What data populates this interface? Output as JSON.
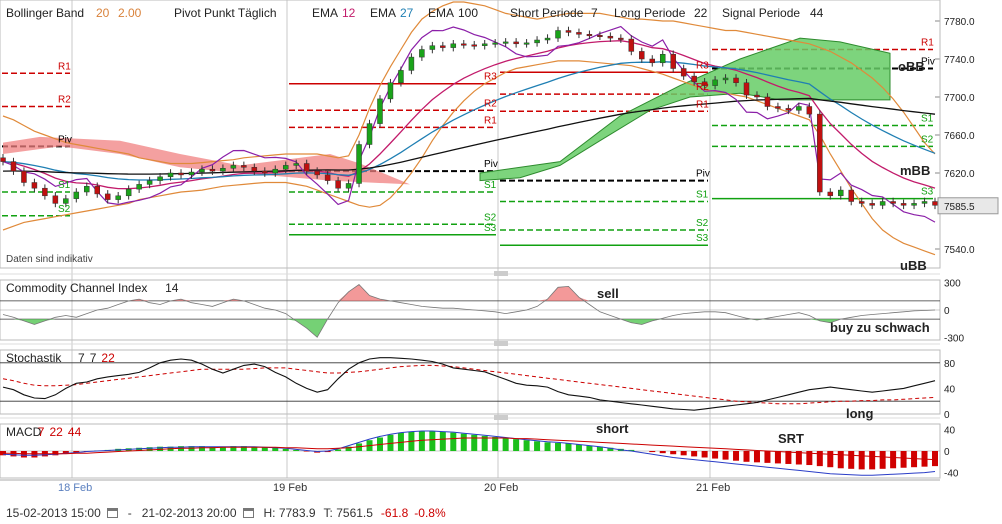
{
  "colors": {
    "red": "#cc0000",
    "green": "#11a111",
    "orange": "#d9823b",
    "purple": "#8b1fa8",
    "ema12": "#c21b6b",
    "ema27": "#1f7fb3",
    "ema100": "#111111",
    "bbLine": "#e08a3a",
    "cloudGreen": "#66cc66",
    "cloudRed": "#f08080"
  },
  "header": {
    "bollinger": {
      "label": "Bollinger Band",
      "p1": "20",
      "p2": "2.00"
    },
    "pivot": "Pivot Punkt Täglich",
    "ema": [
      {
        "label": "EMA",
        "p": "12"
      },
      {
        "label": "EMA",
        "p": "27"
      },
      {
        "label": "EMA",
        "p": "100"
      }
    ],
    "short": {
      "label": "Short Periode",
      "p": "7"
    },
    "long": {
      "label": "Long Periode",
      "p": "22"
    },
    "signal": {
      "label": "Signal Periode",
      "p": "44"
    }
  },
  "indikativ": "Daten sind indikativ",
  "price_ticks": [
    "7780.0",
    "7740.0",
    "7700.0",
    "7660.0",
    "7620.0",
    "7585.5",
    "7540.0"
  ],
  "last_price": "7585.5",
  "annotations": {
    "obb": "oBB",
    "mbb": "mBB",
    "ubb": "uBB",
    "sell": "sell",
    "buy": "buy zu schwach",
    "long": "long",
    "short": "short",
    "srt": "SRT"
  },
  "pivots": {
    "r1": "R1",
    "r2": "R2",
    "r3": "R3",
    "piv": "Piv",
    "s1": "S1",
    "s2": "S2",
    "s3": "S3"
  },
  "cci": {
    "label": "Commodity Channel Index",
    "p": "14",
    "ticks": [
      "300",
      "0",
      "-300"
    ]
  },
  "stoch": {
    "label": "Stochastik",
    "p1": "7",
    "p2": "7",
    "p3": "22",
    "ticks": [
      "80",
      "40",
      "0"
    ]
  },
  "macd": {
    "label": "MACD",
    "p1": "7",
    "p2": "22",
    "p3": "44",
    "ticks": [
      "40",
      "0",
      "-40"
    ]
  },
  "dates": [
    "18 Feb",
    "19 Feb",
    "20 Feb",
    "21 Feb"
  ],
  "footer": {
    "from": "15-02-2013 15:00",
    "sep": "-",
    "to": "21-02-2013 20:00",
    "high": "H: 7783.9",
    "low": "T: 7561.5",
    "chg": "-61.8",
    "pct": "-0.8%"
  },
  "chart_data": {
    "type": "candlestick",
    "title": "",
    "x_range": [
      "15-02-2013 15:00",
      "21-02-2013 20:00"
    ],
    "y_range": [
      7520,
      7800
    ],
    "close": [
      7632,
      7622,
      7610,
      7604,
      7596,
      7588,
      7593,
      7600,
      7606,
      7598,
      7592,
      7596,
      7603,
      7608,
      7612,
      7616,
      7620,
      7618,
      7621,
      7624,
      7622,
      7625,
      7628,
      7626,
      7622,
      7620,
      7624,
      7628,
      7630,
      7622,
      7618,
      7612,
      7604,
      7609,
      7650,
      7672,
      7698,
      7715,
      7728,
      7742,
      7750,
      7754,
      7752,
      7756,
      7755,
      7754,
      7756,
      7757,
      7758,
      7756,
      7757,
      7760,
      7762,
      7770,
      7768,
      7766,
      7765,
      7764,
      7762,
      7761,
      7748,
      7740,
      7736,
      7745,
      7730,
      7722,
      7716,
      7712,
      7718,
      7720,
      7715,
      7702,
      7700,
      7690,
      7688,
      7686,
      7690,
      7682,
      7600,
      7596,
      7602,
      7590,
      7588,
      7586,
      7590,
      7588,
      7586,
      7588,
      7590,
      7586
    ],
    "bb_upper": [
      7680,
      7676,
      7670,
      7664,
      7660,
      7656,
      7652,
      7650,
      7648,
      7646,
      7644,
      7642,
      7640,
      7636,
      7634,
      7632,
      7630,
      7630,
      7630,
      7631,
      7632,
      7633,
      7634,
      7636,
      7637,
      7638,
      7639,
      7640,
      7640,
      7640,
      7640,
      7638,
      7636,
      7638,
      7660,
      7688,
      7712,
      7732,
      7750,
      7768,
      7782,
      7790,
      7796,
      7800,
      7800,
      7798,
      7796,
      7792,
      7788,
      7786,
      7784,
      7782,
      7784,
      7786,
      7788,
      7788,
      7788,
      7788,
      7786,
      7784,
      7782,
      7782,
      7781,
      7780,
      7780,
      7778,
      7776,
      7774,
      7772,
      7770,
      7770,
      7768,
      7766,
      7764,
      7762,
      7760,
      7758,
      7756,
      7752,
      7748,
      7742,
      7736,
      7728,
      7720,
      7710,
      7698,
      7684,
      7668,
      7652,
      7640
    ],
    "bb_lower": [
      7560,
      7564,
      7568,
      7570,
      7572,
      7574,
      7576,
      7578,
      7580,
      7582,
      7584,
      7586,
      7588,
      7592,
      7594,
      7596,
      7598,
      7600,
      7601,
      7602,
      7604,
      7606,
      7607,
      7608,
      7609,
      7610,
      7610,
      7610,
      7608,
      7606,
      7602,
      7598,
      7594,
      7590,
      7586,
      7584,
      7586,
      7594,
      7606,
      7620,
      7636,
      7654,
      7670,
      7684,
      7696,
      7706,
      7714,
      7720,
      7726,
      7730,
      7732,
      7734,
      7736,
      7738,
      7738,
      7738,
      7737,
      7736,
      7735,
      7734,
      7733,
      7730,
      7727,
      7724,
      7720,
      7716,
      7712,
      7708,
      7706,
      7704,
      7702,
      7700,
      7696,
      7692,
      7688,
      7684,
      7680,
      7676,
      7660,
      7640,
      7622,
      7604,
      7588,
      7572,
      7560,
      7552,
      7546,
      7542,
      7538,
      7534
    ],
    "cci": [
      -50,
      -80,
      -120,
      -160,
      -120,
      -80,
      -60,
      -80,
      -40,
      0,
      20,
      60,
      100,
      120,
      80,
      60,
      100,
      120,
      80,
      60,
      40,
      80,
      120,
      100,
      60,
      20,
      0,
      -40,
      -120,
      -200,
      -300,
      -100,
      80,
      200,
      280,
      160,
      120,
      100,
      80,
      60,
      40,
      30,
      20,
      20,
      10,
      0,
      -10,
      -20,
      -40,
      -20,
      0,
      40,
      120,
      250,
      260,
      140,
      60,
      -20,
      -60,
      -100,
      -140,
      -160,
      -120,
      -90,
      -60,
      -40,
      -30,
      -20,
      -20,
      -30,
      -60,
      -90,
      -110,
      -90,
      -70,
      -50,
      -30,
      -60,
      -120,
      -140,
      -100,
      -80,
      -60,
      -50,
      -40,
      -30,
      -20,
      -10,
      -5,
      0
    ],
    "stoch_k": [
      42,
      38,
      30,
      25,
      24,
      30,
      40,
      48,
      50,
      55,
      58,
      60,
      62,
      65,
      72,
      80,
      84,
      86,
      84,
      78,
      70,
      64,
      70,
      76,
      78,
      74,
      65,
      58,
      48,
      40,
      34,
      38,
      55,
      70,
      80,
      86,
      88,
      88,
      87,
      86,
      84,
      82,
      78,
      72,
      70,
      68,
      66,
      60,
      54,
      48,
      45,
      44,
      42,
      35,
      30,
      28,
      26,
      22,
      20,
      18,
      16,
      14,
      12,
      10,
      8,
      7,
      6,
      8,
      10,
      12,
      14,
      16,
      18,
      22,
      26,
      30,
      34,
      38,
      40,
      42,
      40,
      38,
      36,
      34,
      36,
      38,
      40,
      44,
      48,
      52
    ],
    "stoch_d": [
      55,
      52,
      48,
      45,
      44,
      44,
      45,
      46,
      48,
      50,
      52,
      54,
      56,
      58,
      60,
      62,
      64,
      66,
      68,
      70,
      70,
      70,
      70,
      70,
      71,
      72,
      72,
      72,
      70,
      68,
      66,
      64,
      64,
      65,
      66,
      68,
      70,
      72,
      74,
      75,
      76,
      76,
      75,
      74,
      72,
      70,
      68,
      66,
      64,
      62,
      60,
      58,
      56,
      54,
      52,
      50,
      48,
      46,
      44,
      42,
      40,
      38,
      36,
      34,
      32,
      30,
      28,
      26,
      24,
      22,
      20,
      19,
      18,
      17,
      16,
      16,
      16,
      17,
      18,
      19,
      20,
      20,
      21,
      21,
      22,
      22,
      23,
      24,
      25,
      26
    ],
    "macd_hist": [
      -8,
      -10,
      -12,
      -12,
      -10,
      -8,
      -5,
      -3,
      -1,
      1,
      2,
      4,
      5,
      6,
      7,
      8,
      8,
      9,
      9,
      9,
      8,
      8,
      9,
      9,
      8,
      7,
      6,
      4,
      2,
      -1,
      -3,
      -2,
      3,
      8,
      14,
      20,
      25,
      30,
      34,
      36,
      37,
      37,
      36,
      34,
      32,
      30,
      28,
      26,
      24,
      22,
      20,
      18,
      16,
      15,
      14,
      12,
      10,
      8,
      6,
      4,
      2,
      0,
      -2,
      -4,
      -6,
      -8,
      -10,
      -12,
      -14,
      -16,
      -18,
      -20,
      -21,
      -22,
      -23,
      -24,
      -25,
      -26,
      -28,
      -30,
      -32,
      -33,
      -34,
      -34,
      -33,
      -32,
      -31,
      -30,
      -29,
      -28
    ],
    "macd_line": [
      -6,
      -7,
      -8,
      -8,
      -7,
      -6,
      -4,
      -3,
      -1,
      0,
      1,
      2,
      3,
      4,
      5,
      6,
      7,
      7,
      8,
      8,
      8,
      8,
      8,
      8,
      8,
      7,
      6,
      5,
      3,
      1,
      -1,
      0,
      4,
      10,
      16,
      22,
      27,
      31,
      34,
      36,
      37,
      37,
      36,
      35,
      33,
      31,
      29,
      27,
      25,
      23,
      21,
      19,
      17,
      16,
      14,
      12,
      10,
      8,
      5,
      2,
      0,
      -3,
      -6,
      -9,
      -12,
      -14,
      -16,
      -18,
      -20,
      -22,
      -24,
      -26,
      -28,
      -30,
      -32,
      -34,
      -36,
      -38,
      -40,
      -42,
      -43,
      -44,
      -45,
      -45,
      -44,
      -43,
      -42,
      -41,
      -40,
      -38
    ],
    "macd_signal": [
      -4,
      -4,
      -5,
      -5,
      -5,
      -5,
      -5,
      -4,
      -4,
      -3,
      -2,
      -1,
      0,
      1,
      2,
      3,
      4,
      5,
      5,
      6,
      6,
      7,
      7,
      7,
      7,
      7,
      7,
      6,
      6,
      5,
      4,
      4,
      5,
      6,
      8,
      10,
      12,
      14,
      16,
      18,
      20,
      21,
      22,
      23,
      24,
      24,
      24,
      24,
      24,
      23,
      23,
      22,
      21,
      20,
      19,
      18,
      17,
      16,
      15,
      14,
      13,
      12,
      11,
      10,
      9,
      8,
      7,
      6,
      5,
      4,
      3,
      2,
      1,
      0,
      -1,
      -2,
      -3,
      -4,
      -5,
      -6,
      -7,
      -8,
      -9,
      -10,
      -11,
      -12,
      -13,
      -14,
      -15,
      -16
    ]
  }
}
